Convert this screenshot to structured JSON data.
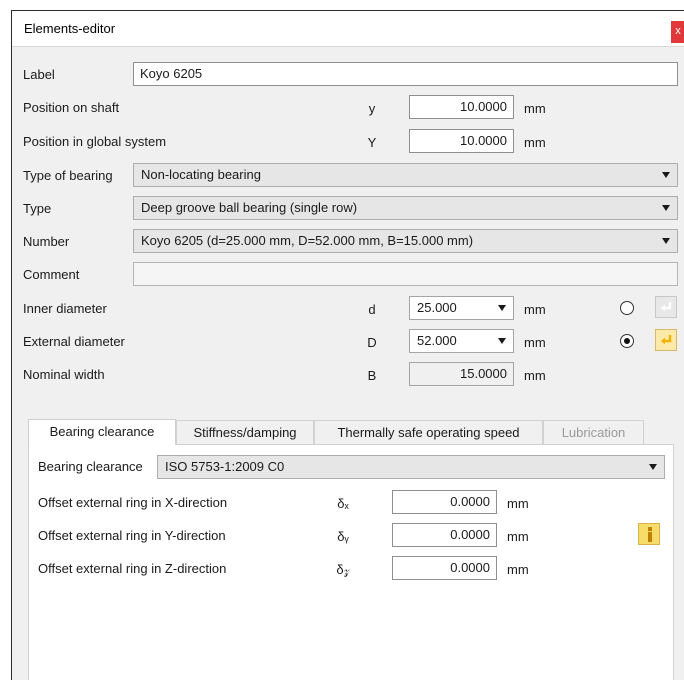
{
  "window": {
    "title": "Elements-editor",
    "close_label": "x"
  },
  "fields": {
    "label": {
      "label": "Label",
      "value": "Koyo 6205"
    },
    "position_on_shaft": {
      "label": "Position on shaft",
      "symbol": "y",
      "value": "10.0000",
      "unit": "mm"
    },
    "position_global": {
      "label": "Position in global system",
      "symbol": "Y",
      "value": "10.0000",
      "unit": "mm"
    },
    "type_of_bearing": {
      "label": "Type of bearing",
      "value": "Non-locating bearing"
    },
    "type": {
      "label": "Type",
      "value": "Deep groove ball bearing (single row)"
    },
    "number": {
      "label": "Number",
      "value": "Koyo 6205 (d=25.000 mm, D=52.000 mm, B=15.000 mm)"
    },
    "comment": {
      "label": "Comment",
      "value": ""
    },
    "inner_diameter": {
      "label": "Inner diameter",
      "symbol": "d",
      "value": "25.000",
      "unit": "mm",
      "selected": false
    },
    "external_diameter": {
      "label": "External diameter",
      "symbol": "D",
      "value": "52.000",
      "unit": "mm",
      "selected": true
    },
    "nominal_width": {
      "label": "Nominal width",
      "symbol": "B",
      "value": "15.0000",
      "unit": "mm"
    }
  },
  "tabs": [
    {
      "label": "Bearing clearance",
      "active": true,
      "disabled": false
    },
    {
      "label": "Stiffness/damping",
      "active": false,
      "disabled": false
    },
    {
      "label": "Thermally safe operating speed",
      "active": false,
      "disabled": false
    },
    {
      "label": "Lubrication",
      "active": false,
      "disabled": true
    }
  ],
  "clearance": {
    "label": "Bearing clearance",
    "value": "ISO 5753-1:2009 C0",
    "offset_x": {
      "label": "Offset external ring in X-direction",
      "symbol": "δₓ",
      "value": "0.0000",
      "unit": "mm"
    },
    "offset_y": {
      "label": "Offset external ring in Y-direction",
      "symbol": "δᵧ",
      "value": "0.0000",
      "unit": "mm"
    },
    "offset_z": {
      "label": "Offset external ring in Z-direction",
      "symbol": "δ𝓏",
      "value": "0.0000",
      "unit": "mm"
    }
  },
  "colors": {
    "accent": "#f0b400",
    "close": "#e0383b",
    "panel": "#f0f0f0"
  },
  "icons": {
    "enter": "enter-arrow-icon",
    "info": "info-icon"
  }
}
